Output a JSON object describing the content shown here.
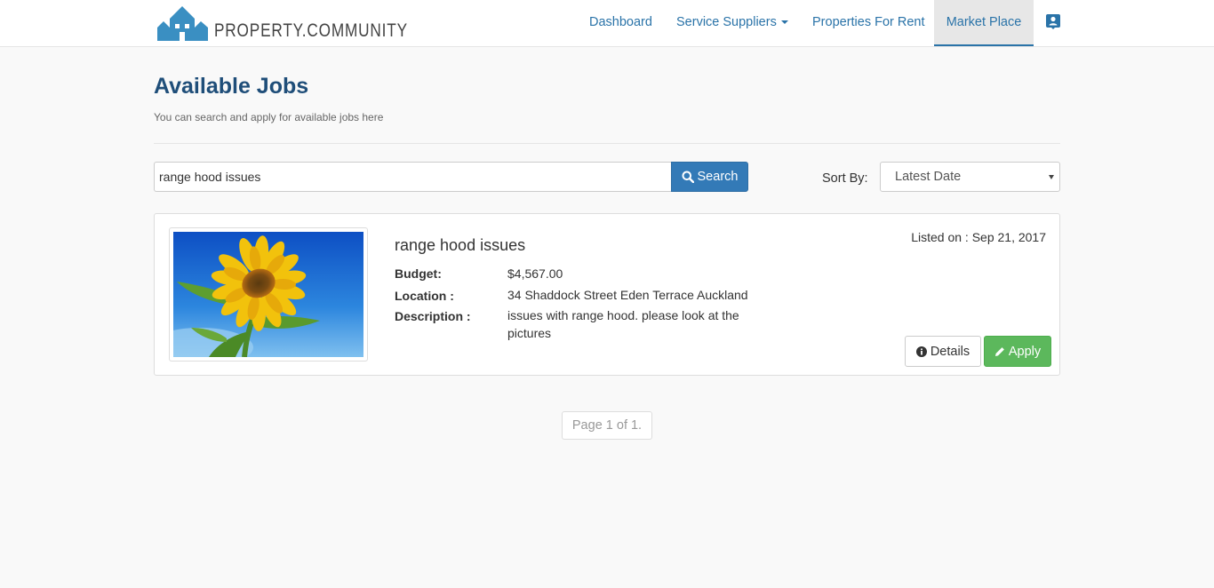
{
  "brand": {
    "name": "PROPERTY.COMMUNITY",
    "color": "#3a8fc2"
  },
  "nav": {
    "items": [
      {
        "label": "Dashboard"
      },
      {
        "label": "Service Suppliers"
      },
      {
        "label": "Properties For Rent"
      },
      {
        "label": "Market Place",
        "active": true
      }
    ],
    "link_color": "#2a73a8",
    "user_icon": "user-profile-icon"
  },
  "header": {
    "title": "Available Jobs",
    "subtitle": "You can search and apply for available jobs here",
    "title_color": "#1f4e79"
  },
  "search": {
    "value": "range hood issues",
    "button_label": "Search",
    "sort_label": "Sort By:",
    "sort_value": "Latest Date"
  },
  "jobs": [
    {
      "title": "range hood issues",
      "listed_on": "Listed on : Sep 21, 2017",
      "budget_label": "Budget:",
      "budget": "$4,567.00",
      "location_label": "Location :",
      "location": "34 Shaddock Street Eden Terrace Auckland",
      "description_label": "Description :",
      "description": "issues with range hood. please look at the pictures",
      "image": "sunflower-photo",
      "details_label": "Details",
      "apply_label": "Apply"
    }
  ],
  "pagination": {
    "text": "Page 1 of 1."
  },
  "colors": {
    "primary": "#337ab7",
    "success": "#5cb85c"
  }
}
